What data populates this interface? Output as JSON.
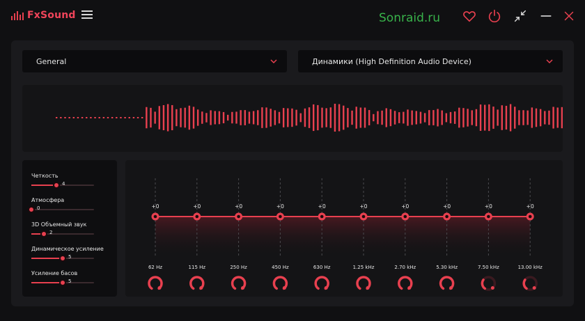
{
  "app": {
    "logo_text": "FxSound",
    "site_label": "Sonraid.ru",
    "accent": "#e8404f"
  },
  "titlebar_icons": [
    "menu-icon",
    "heart-icon",
    "power-icon",
    "minimize-to-mini-icon",
    "minimize-icon",
    "close-icon"
  ],
  "preset_dropdown": {
    "value": "General"
  },
  "device_dropdown": {
    "value": "Динамики (High Definition Audio Device)"
  },
  "effects": [
    {
      "label": "Четкость",
      "value": 4
    },
    {
      "label": "Атмосфера",
      "value": 0
    },
    {
      "label": "3D Объемный звук",
      "value": 2
    },
    {
      "label": "Динамическое усиление",
      "value": 5
    },
    {
      "label": "Усиление басов",
      "value": 5
    }
  ],
  "effect_max": 10,
  "eq": {
    "gain_labels": [
      "+0",
      "+0",
      "+0",
      "+0",
      "+0",
      "+0",
      "+0",
      "+0",
      "+0",
      "+0"
    ],
    "bands": [
      "62 Hz",
      "115 Hz",
      "250 Hz",
      "450 Hz",
      "630 Hz",
      "1.25 kHz",
      "2.70 kHz",
      "5.30 kHz",
      "7.50 kHz",
      "13.00 kHz"
    ]
  }
}
